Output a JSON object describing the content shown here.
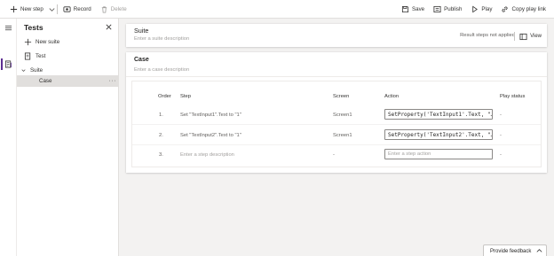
{
  "toolbar": {
    "new_step": "New step",
    "record": "Record",
    "delete": "Delete",
    "save": "Save",
    "publish": "Publish",
    "play": "Play",
    "copy_play_link": "Copy play link"
  },
  "panel": {
    "title": "Tests",
    "new_suite": "New suite",
    "tree": {
      "test": "Test",
      "suite": "Suite",
      "case": "Case"
    },
    "more": "···"
  },
  "suite": {
    "name": "Suite",
    "description_placeholder": "Enter a suite description",
    "status": "Result steps not applied",
    "view": "View"
  },
  "case": {
    "name": "Case",
    "description_placeholder": "Enter a case description"
  },
  "table": {
    "headers": {
      "order": "Order",
      "step": "Step",
      "screen": "Screen",
      "action": "Action",
      "play_status": "Play status"
    },
    "rows": [
      {
        "order": "1.",
        "step": "Set \"TextInput1\".Text to \"1\"",
        "screen": "Screen1",
        "action": "SetProperty('TextInput1'.Text, \"…",
        "play_status": "-"
      },
      {
        "order": "2.",
        "step": "Set \"TextInput2\".Text to \"1\"",
        "screen": "Screen1",
        "action": "SetProperty('TextInput2'.Text, \"…",
        "play_status": "-"
      },
      {
        "order": "3.",
        "step": "Enter a step description",
        "screen": "-",
        "action": "Enter a step action",
        "play_status": "-"
      }
    ]
  },
  "feedback": {
    "label": "Provide feedback"
  },
  "colors": {
    "accent": "#5c2d91",
    "selected_bg": "#e1dfdd",
    "page_bg": "#f3f2f1"
  },
  "icons": {
    "new_step": "plus-icon",
    "new_step_menu": "chevron-down-icon",
    "record": "record-icon",
    "delete": "trash-icon",
    "save": "save-icon",
    "publish": "publish-icon",
    "play": "play-icon",
    "copy_play_link": "link-icon",
    "rail_menu": "hamburger-icon",
    "rail_tests": "tests-icon",
    "close": "close-icon",
    "new_suite": "plus-icon",
    "test": "test-document-icon",
    "suite_toggle": "chevron-down-icon",
    "view": "view-icon",
    "feedback": "chevron-up-icon"
  }
}
